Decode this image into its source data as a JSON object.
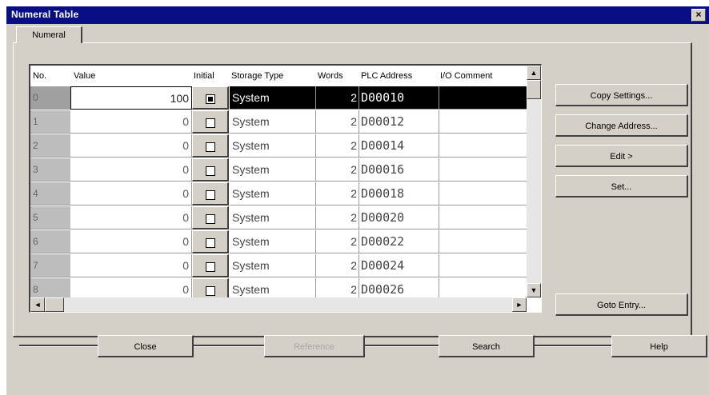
{
  "window": {
    "title": "Numeral Table",
    "close_label": "×"
  },
  "tab": {
    "label": "Numeral"
  },
  "grid": {
    "columns": [
      "No.",
      "Value",
      "Initial",
      "Storage Type",
      "Words",
      "PLC Address",
      "I/O Comment"
    ],
    "rows": [
      {
        "no": "0",
        "value": "100",
        "initial": true,
        "storage": "System",
        "words": "2",
        "address": "D00010",
        "comment": ""
      },
      {
        "no": "1",
        "value": "0",
        "initial": false,
        "storage": "System",
        "words": "2",
        "address": "D00012",
        "comment": ""
      },
      {
        "no": "2",
        "value": "0",
        "initial": false,
        "storage": "System",
        "words": "2",
        "address": "D00014",
        "comment": ""
      },
      {
        "no": "3",
        "value": "0",
        "initial": false,
        "storage": "System",
        "words": "2",
        "address": "D00016",
        "comment": ""
      },
      {
        "no": "4",
        "value": "0",
        "initial": false,
        "storage": "System",
        "words": "2",
        "address": "D00018",
        "comment": ""
      },
      {
        "no": "5",
        "value": "0",
        "initial": false,
        "storage": "System",
        "words": "2",
        "address": "D00020",
        "comment": ""
      },
      {
        "no": "6",
        "value": "0",
        "initial": false,
        "storage": "System",
        "words": "2",
        "address": "D00022",
        "comment": ""
      },
      {
        "no": "7",
        "value": "0",
        "initial": false,
        "storage": "System",
        "words": "2",
        "address": "D00024",
        "comment": ""
      },
      {
        "no": "8",
        "value": "0",
        "initial": false,
        "storage": "System",
        "words": "2",
        "address": "D00026",
        "comment": ""
      }
    ],
    "selected_row": 0
  },
  "side_buttons": {
    "copy_settings": "Copy Settings...",
    "change_address": "Change Address...",
    "edit": "Edit >",
    "set": "Set...",
    "goto_entry": "Goto Entry..."
  },
  "bottom_buttons": {
    "close": "Close",
    "reference": "Reference",
    "search": "Search",
    "help": "Help"
  },
  "scroll_icons": {
    "up": "▲",
    "down": "▼",
    "left": "◄",
    "right": "►"
  },
  "icons": {
    "close": "close-icon",
    "checkbox": "checkbox-icon",
    "scroll_up": "arrow-up-icon",
    "scroll_down": "arrow-down-icon",
    "scroll_left": "arrow-left-icon",
    "scroll_right": "arrow-right-icon"
  },
  "colors": {
    "title_bar": "#0a0e84",
    "face": "#d4d0c8",
    "selection": "#000000",
    "row_header": "#bdbdbd"
  }
}
